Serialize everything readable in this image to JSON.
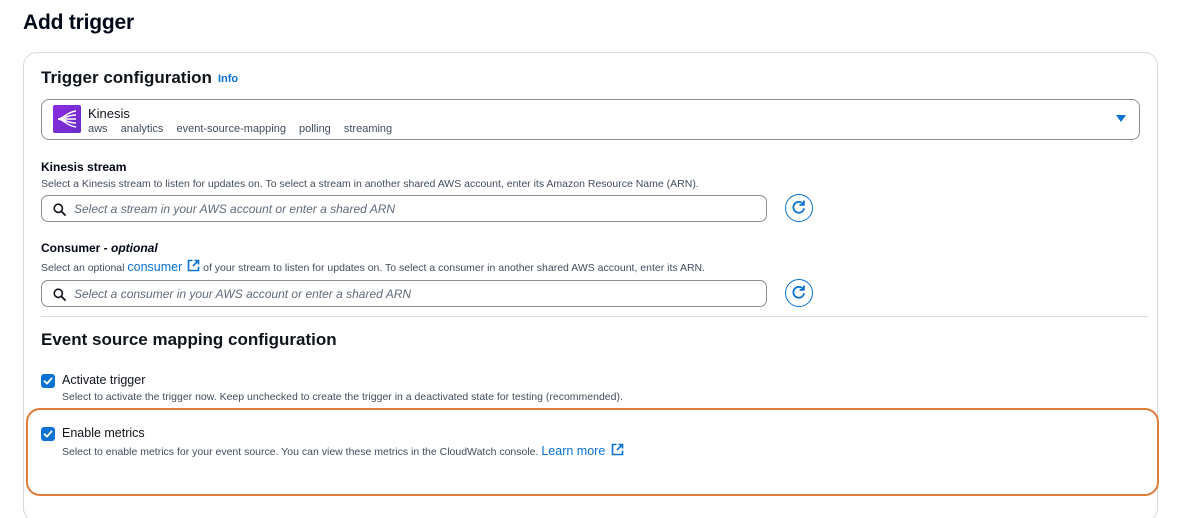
{
  "page": {
    "title": "Add trigger"
  },
  "trigger_config": {
    "title": "Trigger configuration",
    "info_label": "Info",
    "source": {
      "name": "Kinesis",
      "tags": [
        "aws",
        "analytics",
        "event-source-mapping",
        "polling",
        "streaming"
      ]
    },
    "kinesis_stream": {
      "label": "Kinesis stream",
      "description": "Select a Kinesis stream to listen for updates on. To select a stream in another shared AWS account, enter its Amazon Resource Name (ARN).",
      "placeholder": "Select a stream in your AWS account or enter a shared ARN",
      "value": ""
    },
    "consumer": {
      "label_main": "Consumer - ",
      "label_optional": "optional",
      "desc_before": "Select an optional ",
      "desc_link": "consumer",
      "desc_after": " of your stream to listen for updates on. To select a consumer in another shared AWS account, enter its ARN.",
      "placeholder": "Select a consumer in your AWS account or enter a shared ARN",
      "value": ""
    }
  },
  "esm_config": {
    "title": "Event source mapping configuration",
    "activate_trigger": {
      "label": "Activate trigger",
      "checked": true,
      "description": "Select to activate the trigger now. Keep unchecked to create the trigger in a deactivated state for testing (recommended)."
    },
    "enable_metrics": {
      "label": "Enable metrics",
      "checked": true,
      "description": "Select to enable metrics for your event source. You can view these metrics in the CloudWatch console. ",
      "link": "Learn more"
    }
  },
  "colors": {
    "accent": "#0972d3",
    "highlight": "#e07b39",
    "kinesis": "#8c2be0"
  }
}
